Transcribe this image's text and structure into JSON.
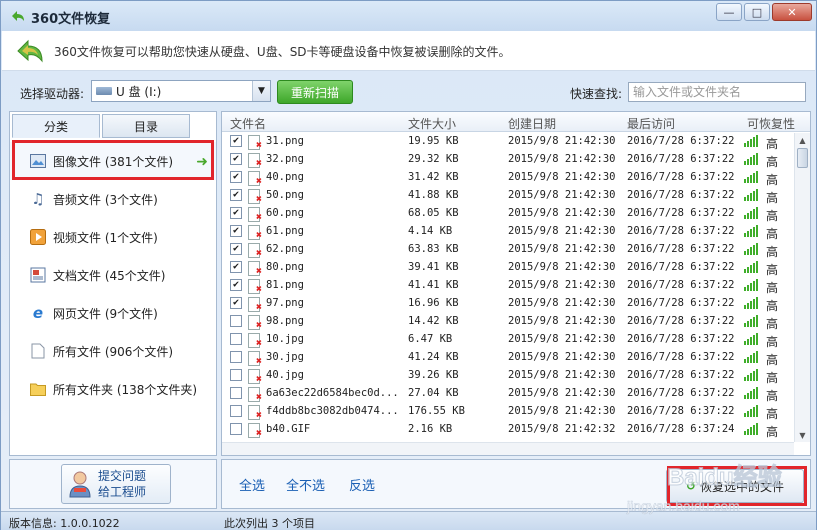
{
  "window": {
    "title": "360文件恢复"
  },
  "banner": {
    "text": "360文件恢复可以帮助您快速从硬盘、U盘、SD卡等硬盘设备中恢复被误删除的文件。"
  },
  "toolbar": {
    "drive_label": "选择驱动器:",
    "drive_value": "U 盘 (I:)",
    "rescan_label": "重新扫描",
    "search_label": "快速查找:",
    "search_placeholder": "输入文件或文件夹名"
  },
  "tabs": [
    {
      "label": "分类",
      "active": true
    },
    {
      "label": "目录",
      "active": false
    }
  ],
  "categories": [
    {
      "label": "图像文件 (381个文件)",
      "icon": "image-icon",
      "selected": true
    },
    {
      "label": "音频文件 (3个文件)",
      "icon": "music-icon"
    },
    {
      "label": "视频文件 (1个文件)",
      "icon": "video-icon"
    },
    {
      "label": "文档文件 (45个文件)",
      "icon": "document-icon"
    },
    {
      "label": "网页文件 (9个文件)",
      "icon": "web-icon"
    },
    {
      "label": "所有文件 (906个文件)",
      "icon": "file-icon"
    },
    {
      "label": "所有文件夹 (138个文件夹)",
      "icon": "folder-icon"
    }
  ],
  "ask": {
    "line1": "提交问题",
    "line2": "给工程师"
  },
  "columns": {
    "name": "文件名",
    "size": "文件大小",
    "created": "创建日期",
    "accessed": "最后访问",
    "recoverability": "可恢复性"
  },
  "files": [
    {
      "checked": true,
      "name": "31.png",
      "size": "19.95 KB",
      "created": "2015/9/8 21:42:30",
      "accessed": "2016/7/28 6:37:22",
      "rec": "高"
    },
    {
      "checked": true,
      "name": "32.png",
      "size": "29.32 KB",
      "created": "2015/9/8 21:42:30",
      "accessed": "2016/7/28 6:37:22",
      "rec": "高"
    },
    {
      "checked": true,
      "name": "40.png",
      "size": "31.42 KB",
      "created": "2015/9/8 21:42:30",
      "accessed": "2016/7/28 6:37:22",
      "rec": "高"
    },
    {
      "checked": true,
      "name": "50.png",
      "size": "41.88 KB",
      "created": "2015/9/8 21:42:30",
      "accessed": "2016/7/28 6:37:22",
      "rec": "高"
    },
    {
      "checked": true,
      "name": "60.png",
      "size": "68.05 KB",
      "created": "2015/9/8 21:42:30",
      "accessed": "2016/7/28 6:37:22",
      "rec": "高"
    },
    {
      "checked": true,
      "name": "61.png",
      "size": "4.14 KB",
      "created": "2015/9/8 21:42:30",
      "accessed": "2016/7/28 6:37:22",
      "rec": "高"
    },
    {
      "checked": true,
      "name": "62.png",
      "size": "63.83 KB",
      "created": "2015/9/8 21:42:30",
      "accessed": "2016/7/28 6:37:22",
      "rec": "高"
    },
    {
      "checked": true,
      "name": "80.png",
      "size": "39.41 KB",
      "created": "2015/9/8 21:42:30",
      "accessed": "2016/7/28 6:37:22",
      "rec": "高"
    },
    {
      "checked": true,
      "name": "81.png",
      "size": "41.41 KB",
      "created": "2015/9/8 21:42:30",
      "accessed": "2016/7/28 6:37:22",
      "rec": "高"
    },
    {
      "checked": true,
      "name": "97.png",
      "size": "16.96 KB",
      "created": "2015/9/8 21:42:30",
      "accessed": "2016/7/28 6:37:22",
      "rec": "高"
    },
    {
      "checked": false,
      "name": "98.png",
      "size": "14.42 KB",
      "created": "2015/9/8 21:42:30",
      "accessed": "2016/7/28 6:37:22",
      "rec": "高"
    },
    {
      "checked": false,
      "name": "10.jpg",
      "size": "6.47 KB",
      "created": "2015/9/8 21:42:30",
      "accessed": "2016/7/28 6:37:22",
      "rec": "高"
    },
    {
      "checked": false,
      "name": "30.jpg",
      "size": "41.24 KB",
      "created": "2015/9/8 21:42:30",
      "accessed": "2016/7/28 6:37:22",
      "rec": "高"
    },
    {
      "checked": false,
      "name": "40.jpg",
      "size": "39.26 KB",
      "created": "2015/9/8 21:42:30",
      "accessed": "2016/7/28 6:37:22",
      "rec": "高"
    },
    {
      "checked": false,
      "name": "6a63ec22d6584bec0d...",
      "size": "27.04 KB",
      "created": "2015/9/8 21:42:30",
      "accessed": "2016/7/28 6:37:22",
      "rec": "高"
    },
    {
      "checked": false,
      "name": "f4ddb8bc3082db0474...",
      "size": "176.55 KB",
      "created": "2015/9/8 21:42:30",
      "accessed": "2016/7/28 6:37:22",
      "rec": "高"
    },
    {
      "checked": false,
      "name": "b40.GIF",
      "size": "2.16 KB",
      "created": "2015/9/8 21:42:32",
      "accessed": "2016/7/28 6:37:24",
      "rec": "高"
    }
  ],
  "actions": {
    "select_all": "全选",
    "select_none": "全不选",
    "invert": "反选",
    "recover": "恢复选中的文件"
  },
  "status": {
    "version": "版本信息: 1.0.0.1022",
    "summary": "此次列出 3 个项目"
  },
  "watermark": {
    "text": "Baidu经验",
    "url": "jingyan.baidu.com"
  },
  "colors": {
    "accent_green": "#3ea72a",
    "highlight_red": "#e1252b",
    "link_blue": "#1a5fb4"
  }
}
